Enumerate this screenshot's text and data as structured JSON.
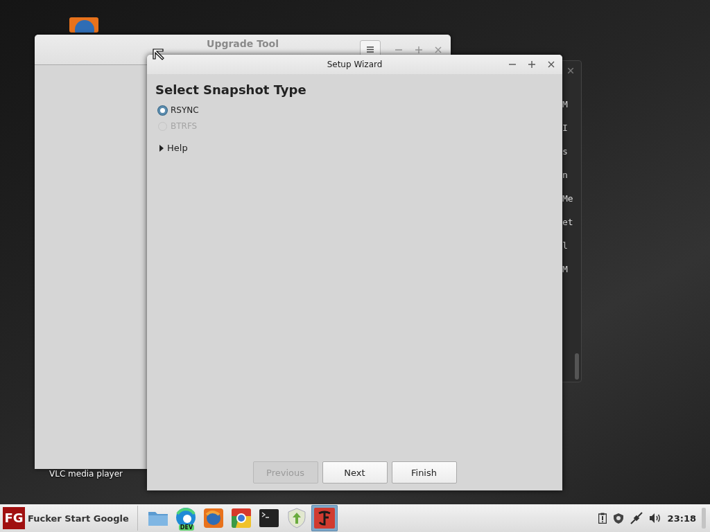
{
  "desktop": {
    "icon_label": "VLC media player"
  },
  "upgrade_tool": {
    "title": "Upgrade Tool"
  },
  "terminal": {
    "lines": [
      "M",
      "I",
      "s",
      "n",
      "Me",
      "et",
      "l",
      "M"
    ]
  },
  "wizard": {
    "title": "Setup Wizard",
    "heading": "Select Snapshot Type",
    "options": [
      {
        "label": "RSYNC",
        "selected": true,
        "disabled": false
      },
      {
        "label": "BTRFS",
        "selected": false,
        "disabled": true
      }
    ],
    "help": {
      "label": "Help",
      "expanded": false
    },
    "buttons": [
      {
        "label": "Previous",
        "disabled": true
      },
      {
        "label": "Next",
        "disabled": false
      },
      {
        "label": "Finish",
        "disabled": false
      }
    ]
  },
  "taskbar": {
    "start_logo": "FG",
    "start_label": "Fucker Start Google",
    "apps": [
      {
        "kind": "folder",
        "selected": false
      },
      {
        "kind": "edge",
        "selected": false,
        "badge": "DEV"
      },
      {
        "kind": "firefox",
        "selected": false
      },
      {
        "kind": "chrome",
        "selected": false
      },
      {
        "kind": "terminal",
        "selected": false
      },
      {
        "kind": "shield",
        "selected": false
      },
      {
        "kind": "redapp",
        "selected": true
      }
    ],
    "clock": "23:18"
  }
}
